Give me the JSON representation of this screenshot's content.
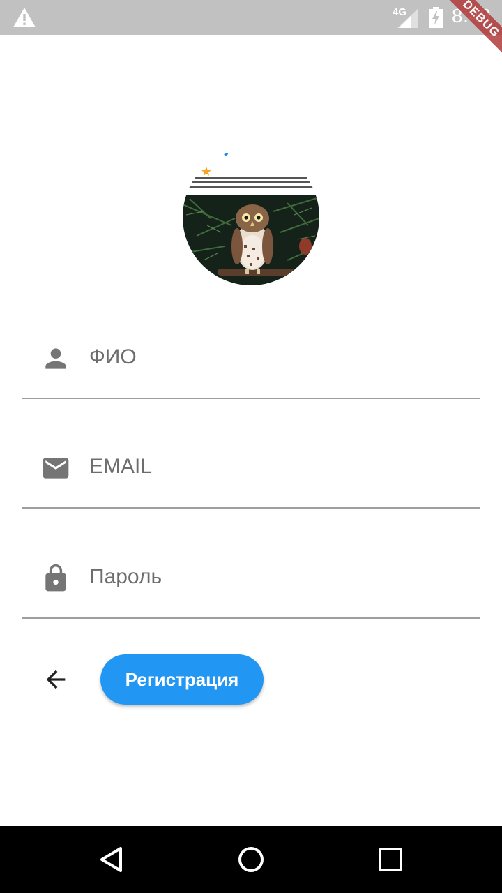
{
  "status_bar": {
    "network": "4G",
    "time": "8:43",
    "icons": [
      "warning-icon",
      "signal-icon",
      "battery-charging-icon"
    ]
  },
  "debug_banner": "DEBUG",
  "avatar": {
    "icon": "owl-photo"
  },
  "form": {
    "name_field": {
      "placeholder": "ФИО",
      "icon": "person-icon"
    },
    "email_field": {
      "placeholder": "EMAIL",
      "icon": "mail-icon"
    },
    "password_field": {
      "placeholder": "Пароль",
      "icon": "lock-icon"
    }
  },
  "actions": {
    "back_icon": "arrow-back-icon",
    "register_label": "Регистрация",
    "register_color": "#2196f3"
  },
  "nav_bar": {
    "icons": [
      "nav-back-icon",
      "nav-home-icon",
      "nav-recents-icon"
    ]
  }
}
